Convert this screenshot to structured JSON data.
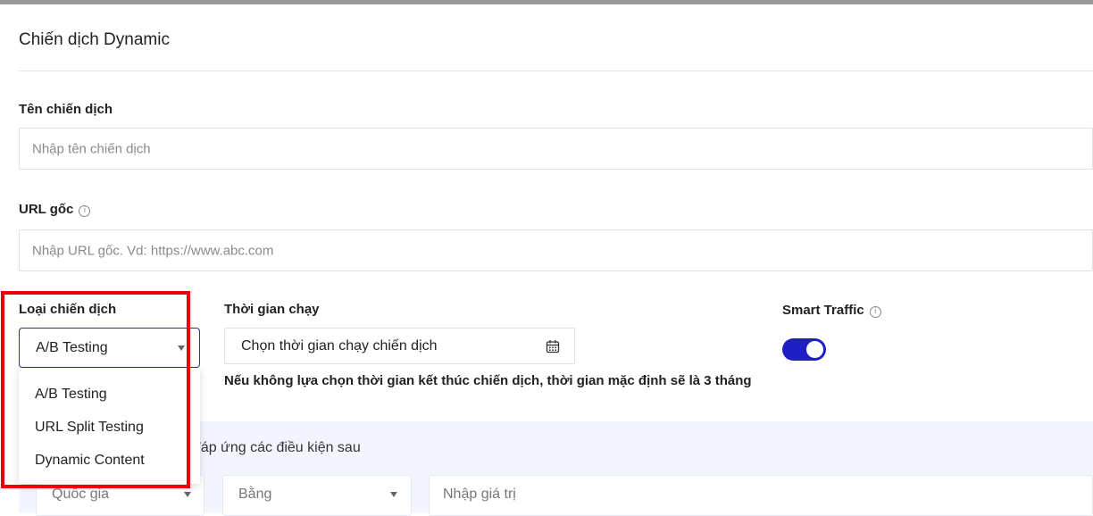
{
  "page": {
    "title": "Chiến dịch Dynamic"
  },
  "campaign_name": {
    "label": "Tên chiến dịch",
    "placeholder": "Nhập tên chiến dịch"
  },
  "base_url": {
    "label": "URL gốc",
    "placeholder": "Nhập URL gốc. Vd: https://www.abc.com",
    "info_icon": "info-icon"
  },
  "campaign_type": {
    "label": "Loại chiến dịch",
    "selected": "A/B Testing",
    "options": [
      "A/B Testing",
      "URL Split Testing",
      "Dynamic Content"
    ],
    "highlight_color": "#e8000b"
  },
  "run_time": {
    "label": "Thời gian chạy",
    "value": "Chọn thời gian chạy chiến dịch",
    "note": "Nếu không lựa chọn thời gian kết thúc chiến dịch, thời gian mặc định sẽ là 3 tháng",
    "icon": "calendar-icon"
  },
  "smart_traffic": {
    "label": "Smart Traffic",
    "enabled": true,
    "toggle_color": "#1f1fc4",
    "info_icon": "info-icon"
  },
  "conditions": {
    "text_partial": "đáp ứng các điều kiện sau",
    "field1": "Quốc gia",
    "field2": "Bằng",
    "value_placeholder": "Nhập giá trị",
    "panel_color": "#f2f5fd"
  }
}
